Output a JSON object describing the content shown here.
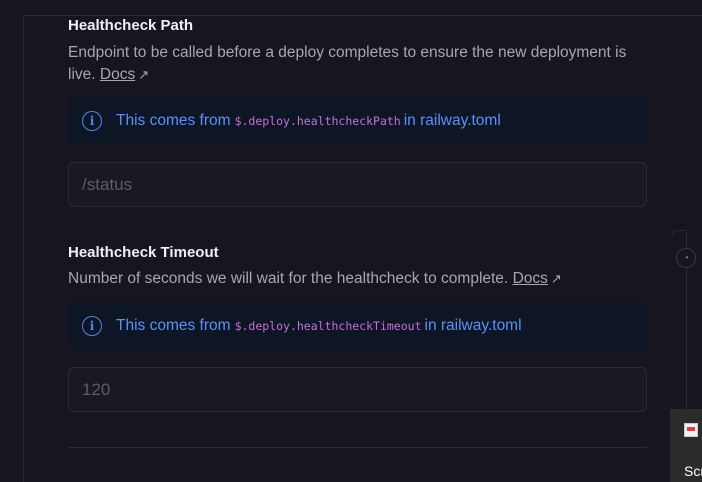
{
  "path_section": {
    "title": "Healthcheck Path",
    "description": "Endpoint to be called before a deploy completes to ensure the new deployment is live.",
    "docs_label": "Docs",
    "info": {
      "prefix": "This comes from",
      "code": "$.deploy.healthcheckPath",
      "suffix": "in railway.toml"
    },
    "input_placeholder": "/status"
  },
  "timeout_section": {
    "title": "Healthcheck Timeout",
    "description": "Number of seconds we will wait for the healthcheck to complete.",
    "docs_label": "Docs",
    "info": {
      "prefix": "This comes from",
      "code": "$.deploy.healthcheckTimeout",
      "suffix": "in railway.toml"
    },
    "input_placeholder": "120"
  },
  "taskbar": {
    "label": "Scr"
  },
  "icons": {
    "info": "info-icon",
    "external_link": "external-link-icon",
    "scroll_knob": "history-icon"
  },
  "colors": {
    "background": "#17151f",
    "info_bg": "#0e1626",
    "info_text": "#5b91f5",
    "code_text": "#c56fd8"
  }
}
